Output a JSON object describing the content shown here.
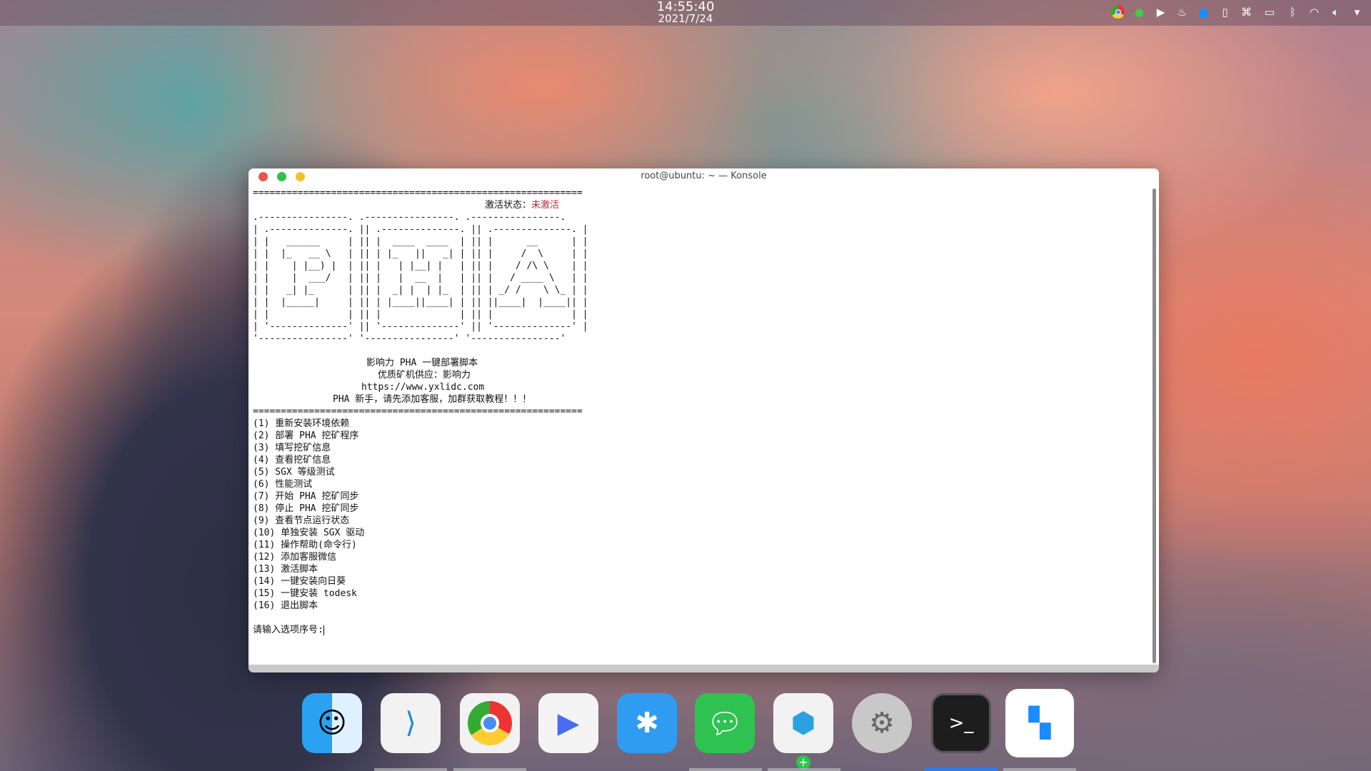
{
  "menubar": {
    "time": "14:55:40",
    "date": "2021/7/24",
    "tray_icons": [
      "chrome-icon",
      "wechat-icon",
      "play-icon",
      "flame-icon",
      "todesk-icon",
      "clipboard-icon",
      "command-icon",
      "battery-icon",
      "bluetooth-icon",
      "wifi-icon",
      "volume-icon",
      "dropdown-icon"
    ]
  },
  "window": {
    "title": "root@ubuntu: ~ — Konsole"
  },
  "terminal": {
    "separator": "===========================================================",
    "status_label": "激活状态：",
    "status_value": "未激活",
    "status_color": "#c0262a",
    "ascii_art": [
      ".----------------. .----------------. .----------------.",
      "| .--------------. || .--------------. || .--------------. |",
      "| |   ______     | || |  ____  ____  | || |      __      | |",
      "| |  |_   __ \\   | || | |_   ||   _| | || |     /  \\     | |",
      "| |    | |__) |  | || |   | |__| |   | || |    / /\\ \\    | |",
      "| |    |  ___/   | || |   |  __  |   | || |   / ____ \\   | |",
      "| |   _| |_      | || |  _| |  | |_  | || | _/ /    \\ \\_ | |",
      "| |  |_____|     | || | |____||____| | || ||____|  |____|| |",
      "| |              | || |              | || |              | |",
      "| '--------------' || '--------------' || '--------------' |",
      "'----------------' '----------------' '----------------'"
    ],
    "info": [
      "影响力 PHA 一键部署脚本",
      "优质矿机供应：影响力",
      "https://www.yxlidc.com",
      "PHA 新手，请先添加客服，加群获取教程！！！"
    ],
    "menu": [
      "(1) 重新安装环境依赖",
      "(2) 部署 PHA 挖矿程序",
      "(3) 填写挖矿信息",
      "(4) 查看挖矿信息",
      "(5) SGX 等级测试",
      "(6) 性能测试",
      "(7) 开始 PHA 挖矿同步",
      "(8) 停止 PHA 挖矿同步",
      "(9) 查看节点运行状态",
      "(10) 单独安装 SGX 驱动",
      "(11) 操作帮助(命令行)",
      "(12) 添加客服微信",
      "(13) 激活脚本",
      "(14) 一键安装向日葵",
      "(15) 一键安装 todesk",
      "(16) 退出脚本"
    ],
    "prompt": "请输入选项序号:"
  },
  "dock": [
    "finder",
    "vscode",
    "chrome",
    "video-player",
    "deepin-app-store",
    "wechat",
    "system-monitor",
    "system-settings",
    "terminal",
    "todesk"
  ]
}
